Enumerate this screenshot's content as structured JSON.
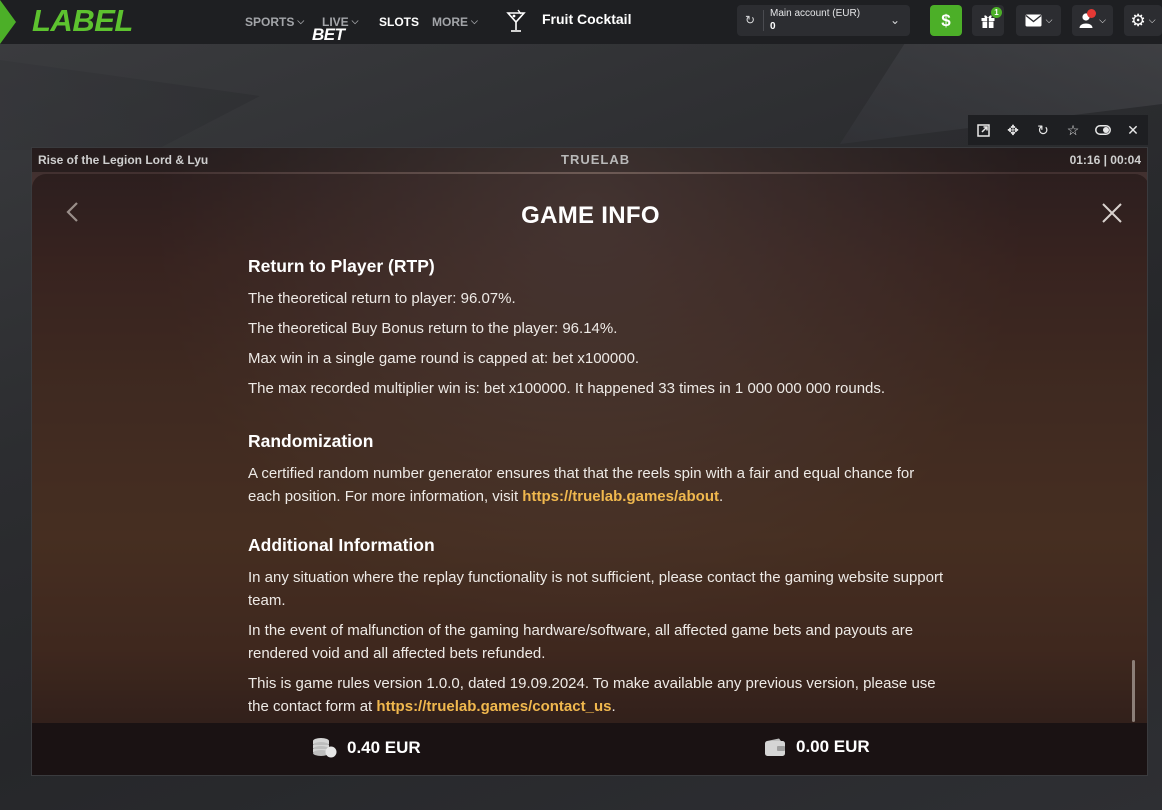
{
  "brand": {
    "part1": "BET",
    "part2": "LABEL"
  },
  "nav": {
    "sports": "SPORTS",
    "live": "LIVE",
    "slots": "SLOTS",
    "more": "MORE"
  },
  "current_game": "Fruit Cocktail",
  "account": {
    "label": "Main account  (EUR)",
    "value": "0"
  },
  "gift_badge": "1",
  "game_strip": {
    "title": "Rise of the Legion Lord & Lyu",
    "provider": "TRUELAB",
    "time": "01:16 | 00:04"
  },
  "modal": {
    "title": "GAME INFO",
    "sections": [
      {
        "heading": "Return to Player (RTP)",
        "paragraphs": [
          "The theoretical return to player: 96.07%.",
          "The theoretical Buy Bonus return to the player: 96.14%.",
          "Max win in a single game round is capped at: bet x100000.",
          "The max recorded multiplier win is: bet x100000. It happened 33 times in 1 000 000 000 rounds."
        ]
      },
      {
        "heading": "Randomization",
        "paragraphs": [
          "A certified random number generator ensures that that the reels spin with a fair and equal chance for each position. For more information, visit"
        ],
        "link": "https://truelab.games/about",
        "link_suffix": "."
      },
      {
        "heading": "Additional Information",
        "paragraphs": [
          "In any situation where the replay functionality is not sufficient, please contact the gaming website support team.",
          "In the event of malfunction of the gaming hardware/software, all affected game bets and payouts are rendered void and all affected bets refunded.",
          "This is game rules version 1.0.0, dated 19.09.2024. To make available any previous version, please use the contact form at"
        ],
        "link": "https://truelab.games/contact_us",
        "link_suffix": "."
      }
    ]
  },
  "footer": {
    "bet": "0.40 EUR",
    "balance": "0.00 EUR"
  },
  "colors": {
    "accent_green": "#4caf28",
    "link": "#f0b84e",
    "notification": "#e53935"
  },
  "icons": [
    "refresh-icon",
    "chevron-down-icon",
    "dollar-icon",
    "gift-icon",
    "mail-icon",
    "user-icon",
    "gear-icon",
    "open-external-icon",
    "move-icon",
    "reload-icon",
    "star-icon",
    "toggle-icon",
    "close-icon",
    "back-icon",
    "coins-icon",
    "wallet-icon",
    "cocktail-icon"
  ]
}
